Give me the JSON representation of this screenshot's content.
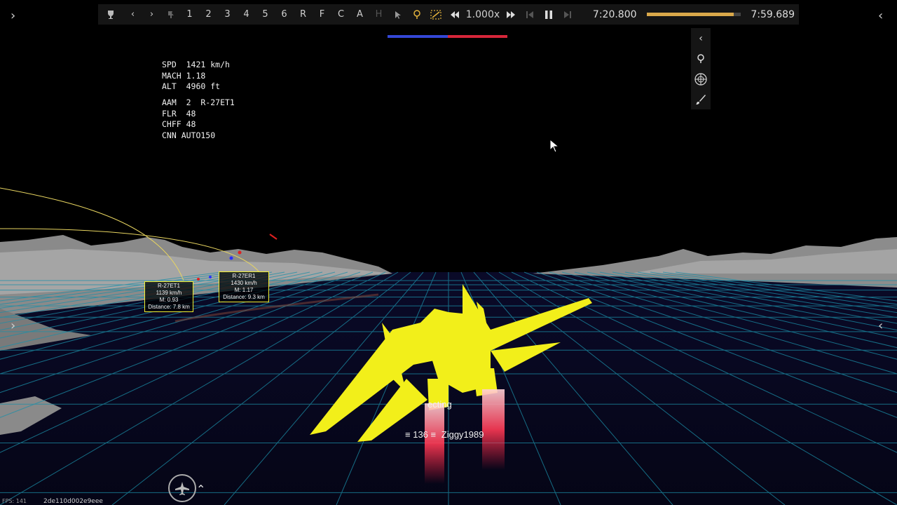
{
  "toolbar": {
    "cameras": [
      "1",
      "2",
      "3",
      "4",
      "5",
      "6",
      "R",
      "F",
      "C",
      "A",
      "H"
    ],
    "speed": "1.000x",
    "current_time": "7:20.800",
    "end_time": "7:59.689",
    "progress": 0.925
  },
  "hud": {
    "lines_top": "SPD  1421 km/h\nMACH 1.18\nALT  4960 ft",
    "lines_bottom": "AAM  2  R-27ET1\nFLR  48\nCHFF 48\nCNN AUTO150"
  },
  "missiles": [
    {
      "name": "R-27ET1",
      "speed": "1139 km/h",
      "mach": "M: 0.93",
      "distance": "Distance: 7.8 km"
    },
    {
      "name": "R-27ER1",
      "speed": "1430 km/h",
      "mach": "M: 1.17",
      "distance": "Distance: 9.3 km"
    }
  ],
  "player": {
    "name": "Ziggy1989",
    "tag": "ecting",
    "number": "136"
  },
  "footer": {
    "fps": "FPS: 141",
    "session": "2de110d002e9eee"
  },
  "colors": {
    "jet": "#f2ef1a",
    "grid": "#1b8fa8",
    "team_blue": "#3447d6",
    "team_red": "#d7263a",
    "progress": "#d9a84a"
  }
}
